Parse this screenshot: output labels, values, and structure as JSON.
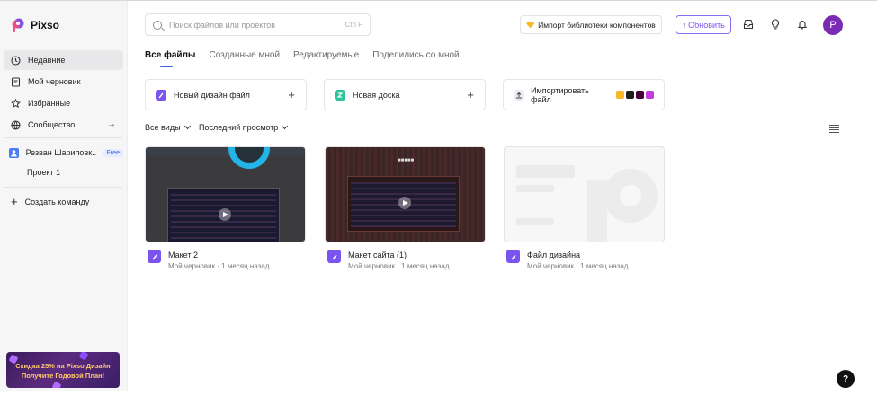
{
  "app": {
    "name": "Pixso"
  },
  "sidebar": {
    "items": [
      {
        "label": "Недавние",
        "icon": "clock-icon",
        "active": true
      },
      {
        "label": "Мой черновик",
        "icon": "draft-icon",
        "active": false
      },
      {
        "label": "Избранные",
        "icon": "star-icon",
        "active": false
      },
      {
        "label": "Сообщество",
        "icon": "globe-icon",
        "active": false
      }
    ],
    "team": {
      "name": "Резван Шариповк...",
      "badge": "Free"
    },
    "project": "Проект 1",
    "create_team": "Создать команду",
    "promo": {
      "line1": "Скидка 25% на Pixso Дизайн",
      "line2": "Получите Годовой План!"
    }
  },
  "header": {
    "search": {
      "placeholder": "Поиск файлов или проектов",
      "shortcut": "Ctrl F"
    },
    "import_library": "Импорт библиотеки компонентов",
    "upgrade": "↑ Обновить",
    "avatar_letter": "P"
  },
  "tabs": [
    {
      "label": "Все файлы",
      "active": true
    },
    {
      "label": "Созданные мной",
      "active": false
    },
    {
      "label": "Редактируемые",
      "active": false
    },
    {
      "label": "Поделились со мной",
      "active": false
    }
  ],
  "actions": [
    {
      "label": "Новый дизайн файл",
      "icon": "design-file-icon",
      "color": "#7b54f0"
    },
    {
      "label": "Новая доска",
      "icon": "whiteboard-icon",
      "color": "#2fc29b"
    },
    {
      "label": "Импортировать файл",
      "icon": "upload-icon",
      "color": "#e9ecf2"
    }
  ],
  "filters": {
    "view": "Все виды",
    "sort": "Последний просмотр"
  },
  "files": [
    {
      "name": "Макет 2",
      "meta": "Мой черновик · 1 месяц назад"
    },
    {
      "name": "Макет сайта (1)",
      "meta": "Мой черновик · 1 месяц назад"
    },
    {
      "name": "Файл дизайна",
      "meta": "Мой черновик · 1 месяц назад"
    }
  ],
  "help": "?"
}
